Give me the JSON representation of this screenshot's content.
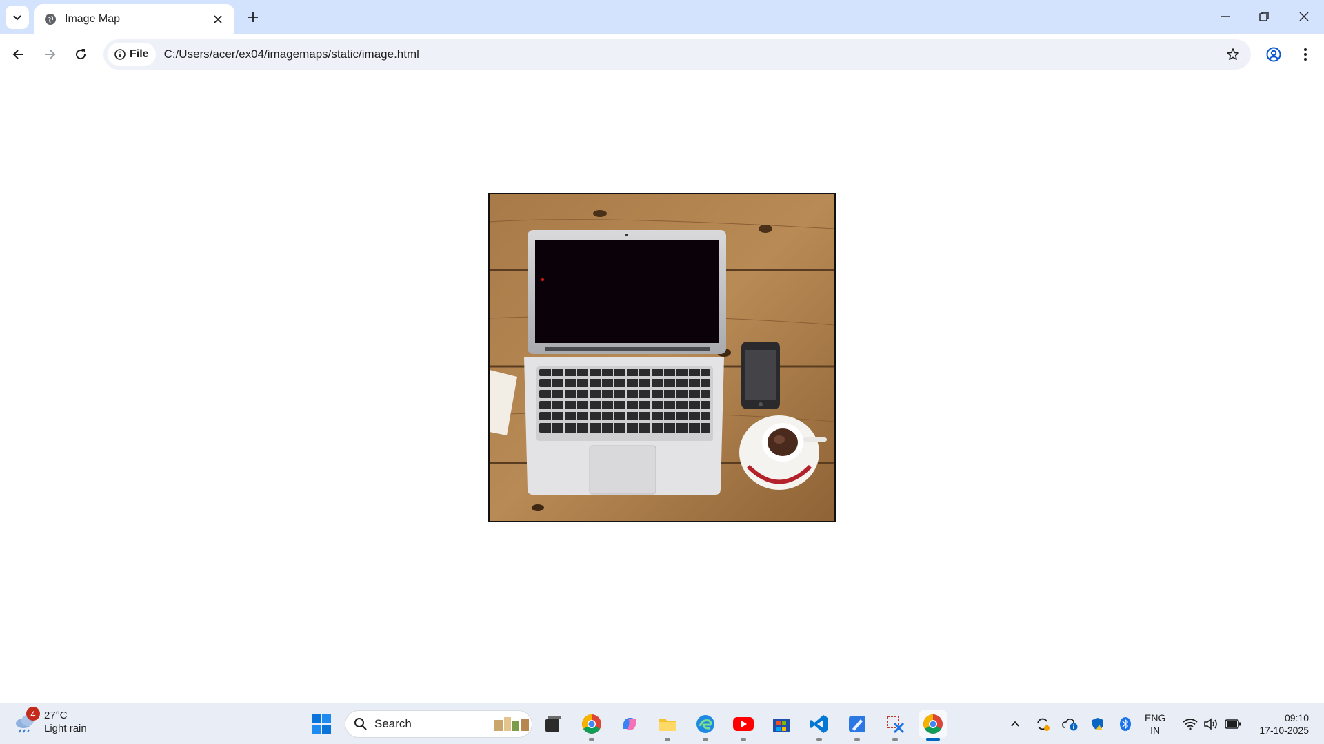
{
  "browser": {
    "tab_title": "Image Map",
    "address_chip": "File",
    "url": "C:/Users/acer/ex04/imagemaps/static/image.html"
  },
  "page": {
    "image_description_alt": "Laptop, phone and coffee cup on wooden desk"
  },
  "taskbar": {
    "weather_temp": "27°C",
    "weather_desc": "Light rain",
    "weather_badge": "4",
    "search_label": "Search",
    "lang_line1": "ENG",
    "lang_line2": "IN",
    "time": "09:10",
    "date": "17-10-2025"
  }
}
